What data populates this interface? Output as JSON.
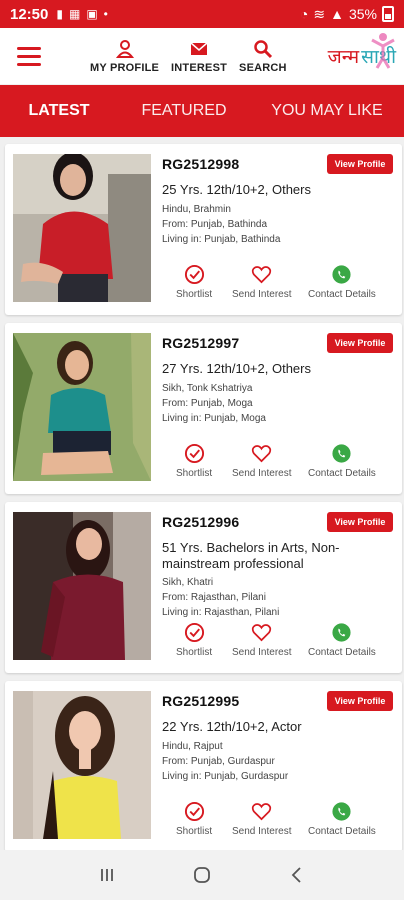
{
  "status": {
    "time": "12:50",
    "battery": "35%"
  },
  "nav": {
    "my_profile": "MY PROFILE",
    "interest": "INTEREST",
    "search": "SEARCH"
  },
  "logo": {
    "part1": "जन्म",
    "part2": "साथी"
  },
  "tabs": [
    "LATEST",
    "FEATURED",
    "YOU MAY LIKE"
  ],
  "profiles": [
    {
      "id": "RG2512998",
      "headline": "25 Yrs. 12th/10+2, Others",
      "religion": "Hindu, Brahmin",
      "from": "From: Punjab, Bathinda",
      "living": "Living in: Punjab, Bathinda",
      "view_label": "View Profile",
      "shortlist": "Shortlist",
      "send_interest": "Send Interest",
      "contact": "Contact Details"
    },
    {
      "id": "RG2512997",
      "headline": "27 Yrs. 12th/10+2, Others",
      "religion": "Sikh, Tonk Kshatriya",
      "from": "From: Punjab, Moga",
      "living": "Living in: Punjab, Moga",
      "view_label": "View Profile",
      "shortlist": "Shortlist",
      "send_interest": "Send Interest",
      "contact": "Contact Details"
    },
    {
      "id": "RG2512996",
      "headline": "51 Yrs. Bachelors in Arts, Non-mainstream professional",
      "religion": "Sikh, Khatri",
      "from": "From: Rajasthan, Pilani",
      "living": "Living in: Rajasthan, Pilani",
      "view_label": "View Profile",
      "shortlist": "Shortlist",
      "send_interest": "Send Interest",
      "contact": "Contact Details"
    },
    {
      "id": "RG2512995",
      "headline": "22 Yrs. 12th/10+2, Actor",
      "religion": "Hindu, Rajput",
      "from": "From: Punjab, Gurdaspur",
      "living": "Living in: Punjab, Gurdaspur",
      "view_label": "View Profile",
      "shortlist": "Shortlist",
      "send_interest": "Send Interest",
      "contact": "Contact Details"
    }
  ],
  "colors": {
    "brand": "#d71920",
    "contact": "#3aa845",
    "logo_accent": "#2aa7b5"
  },
  "icons": {
    "nav": [
      "user-icon",
      "envelope-icon",
      "search-icon"
    ],
    "actions": [
      "check-circle-icon",
      "heart-outline-icon",
      "whatsapp-icon"
    ],
    "system": [
      "recents-icon",
      "home-icon",
      "back-icon"
    ]
  }
}
